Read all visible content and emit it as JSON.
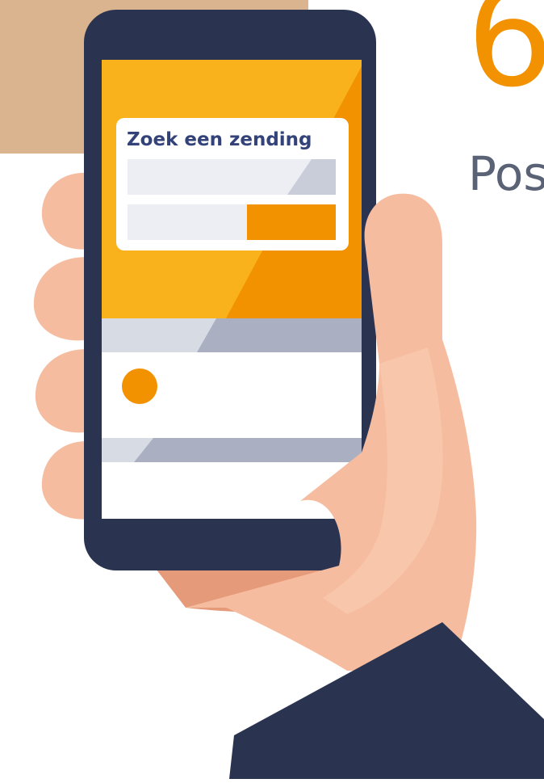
{
  "heading": {
    "number": "6",
    "subtitle": "Pos"
  },
  "phone_screen": {
    "search_card": {
      "title": "Zoek een zending",
      "search_field_value": "",
      "secondary_field_value": "",
      "search_button_label": ""
    }
  },
  "colors": {
    "tan_background": "#d9b48e",
    "phone_frame": "#2a3350",
    "screen_header_yellow": "#f9b21b",
    "screen_header_orange": "#f29200",
    "card_background": "#ffffff",
    "field_light": "#eceef4",
    "field_shadow": "#c9cdd9",
    "accent_button": "#f29200",
    "skin": "#f6bc9f",
    "skin_shadow": "#eea686",
    "sleeve": "#2a3350",
    "heading_number": "#f29200",
    "heading_subtitle": "#5a6275"
  },
  "icons": [
    "location-dot-icon"
  ]
}
